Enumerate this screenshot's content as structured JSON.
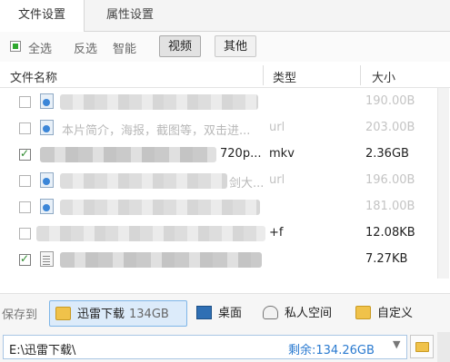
{
  "tabs": [
    {
      "label": "文件设置",
      "active": true
    },
    {
      "label": "属性设置",
      "active": false
    }
  ],
  "filter": {
    "select_all": "全选",
    "invert": "反选",
    "smart": "智能",
    "video_button": "视频",
    "other_button": "其他"
  },
  "table": {
    "headers": {
      "name": "文件名称",
      "type": "类型",
      "size": "大小"
    },
    "rows": [
      {
        "checked": false,
        "name": "",
        "type": "",
        "size": "190.00B",
        "dim": true
      },
      {
        "checked": false,
        "name": "本片简介，海报，截图等，双击进...",
        "type": "url",
        "size": "203.00B",
        "dim": true
      },
      {
        "checked": true,
        "name": "720p...",
        "type": "mkv",
        "size": "2.36GB",
        "dim": false
      },
      {
        "checked": false,
        "name": "剑大...",
        "type": "url",
        "size": "196.00B",
        "dim": true
      },
      {
        "checked": false,
        "name": "",
        "type": "",
        "size": "181.00B",
        "dim": true
      },
      {
        "checked": false,
        "name": "",
        "type": "+f",
        "size": "12.08KB",
        "dim": false
      },
      {
        "checked": true,
        "name": "",
        "type": "",
        "size": "7.27KB",
        "dim": false
      }
    ]
  },
  "save": {
    "label": "保存到",
    "destinations": [
      {
        "label": "迅雷下载",
        "extra": "134GB",
        "icon": "download-folder-icon",
        "selected": true
      },
      {
        "label": "桌面",
        "icon": "desktop-icon",
        "selected": false
      },
      {
        "label": "私人空间",
        "icon": "private-space-icon",
        "selected": false
      },
      {
        "label": "自定义",
        "icon": "custom-folder-icon",
        "selected": false
      }
    ]
  },
  "path": {
    "value": "E:\\迅雷下载\\",
    "free_space": "剩余:134.26GB"
  },
  "colors": {
    "accent": "#2a7ad0",
    "selected_bg": "#dcebfa",
    "check": "#2f8a2f"
  }
}
